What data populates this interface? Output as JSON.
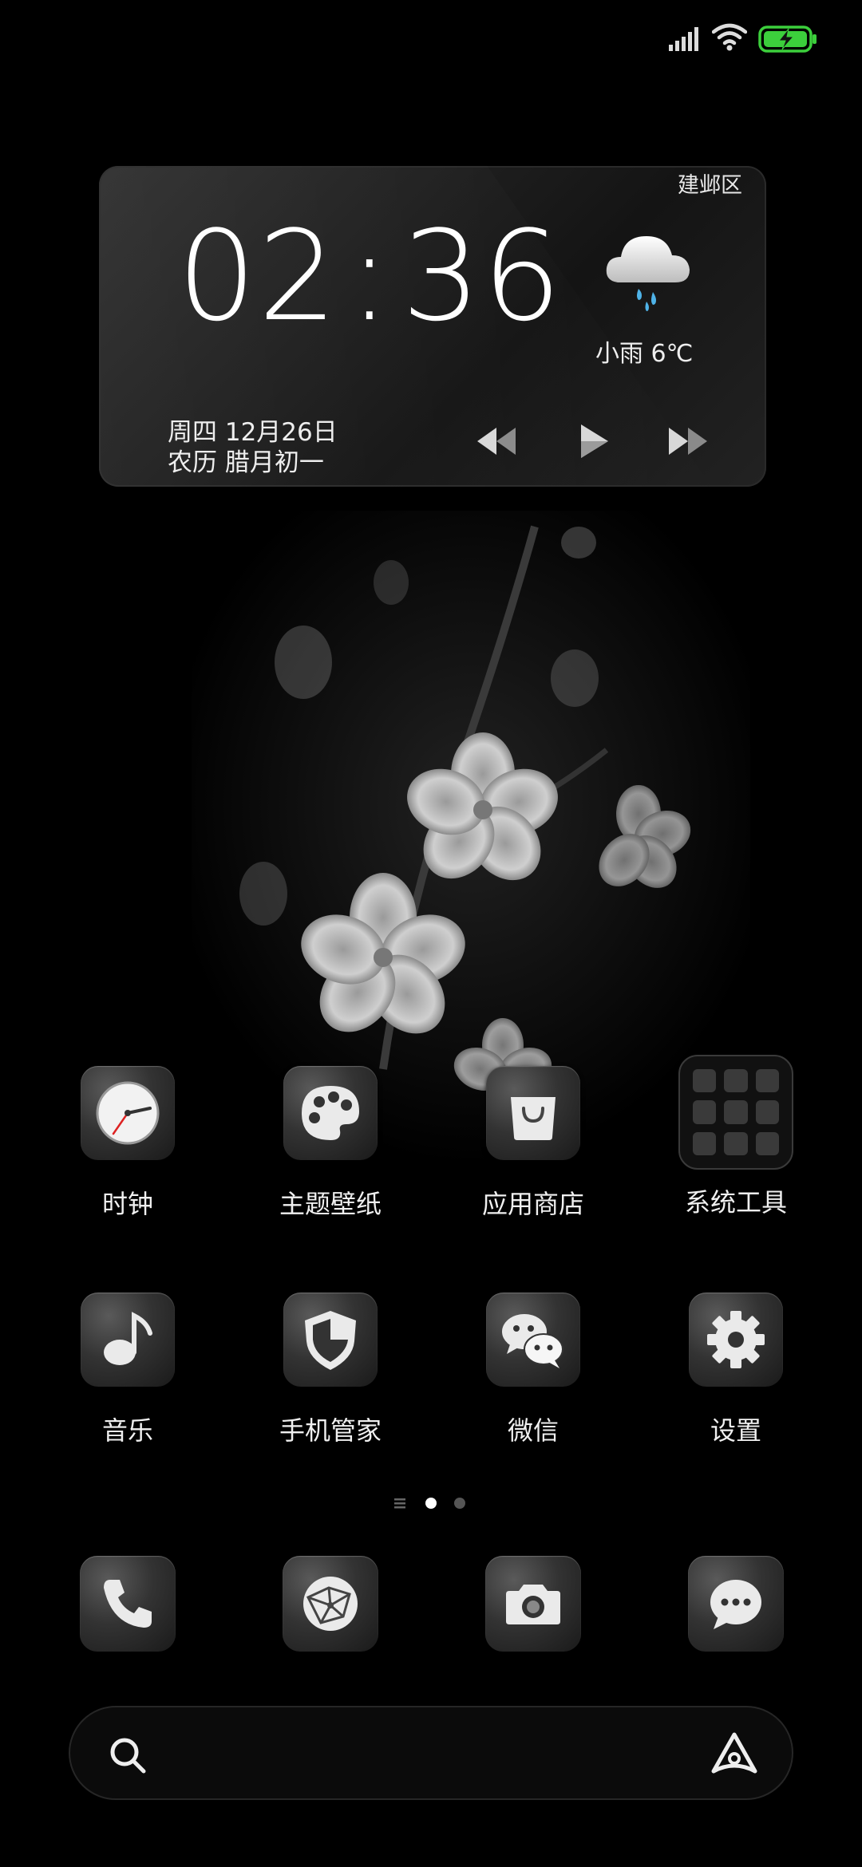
{
  "status_bar": {
    "icons": [
      "signal-icon",
      "wifi-icon",
      "battery-charging-icon"
    ],
    "battery_color": "#3ccf3c"
  },
  "widget": {
    "location": "建邺区",
    "time_hours": "02",
    "time_separator": ":",
    "time_minutes": "36",
    "weather": "小雨  6℃",
    "weather_icon": "rain-cloud-icon",
    "date": "周四 12月26日",
    "lunar_date": "农历 腊月初一",
    "media_controls": [
      "previous-icon",
      "play-icon",
      "next-icon"
    ]
  },
  "apps": [
    {
      "label": "时钟",
      "icon": "clock-icon"
    },
    {
      "label": "主题壁纸",
      "icon": "palette-icon"
    },
    {
      "label": "应用商店",
      "icon": "shopping-bag-icon"
    },
    {
      "label": "系统工具",
      "icon": "folder-icon"
    },
    {
      "label": "音乐",
      "icon": "music-note-icon"
    },
    {
      "label": "手机管家",
      "icon": "shield-icon"
    },
    {
      "label": "微信",
      "icon": "wechat-icon"
    },
    {
      "label": "设置",
      "icon": "gear-icon"
    }
  ],
  "page_indicator": {
    "pages": 2,
    "current": 1
  },
  "dock": [
    {
      "icon": "phone-icon"
    },
    {
      "icon": "browser-icon"
    },
    {
      "icon": "camera-icon"
    },
    {
      "icon": "messages-icon"
    }
  ],
  "search": {
    "icon": "search-icon",
    "assistant_icon": "assistant-icon"
  }
}
